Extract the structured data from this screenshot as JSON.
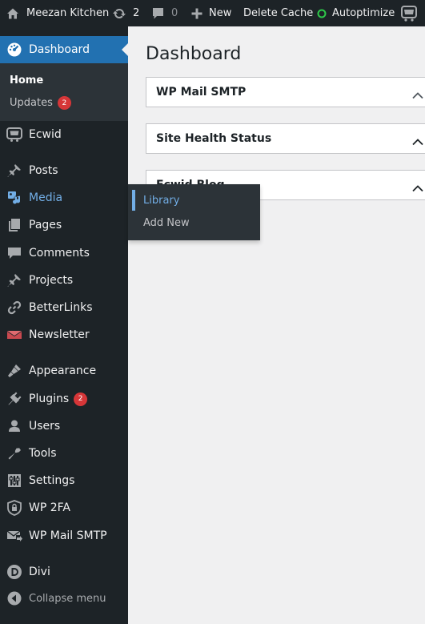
{
  "adminbar": {
    "site_name": "Meezan Kitchen",
    "updates_count": "2",
    "comments_count": "0",
    "new_label": "New",
    "delete_cache_label": "Delete Cache",
    "autoptimize_label": "Autoptimize"
  },
  "sidebar": {
    "dashboard": "Dashboard",
    "home": "Home",
    "updates": "Updates",
    "updates_badge": "2",
    "ecwid": "Ecwid",
    "posts": "Posts",
    "media": "Media",
    "pages": "Pages",
    "comments": "Comments",
    "projects": "Projects",
    "betterlinks": "BetterLinks",
    "newsletter": "Newsletter",
    "appearance": "Appearance",
    "plugins": "Plugins",
    "plugins_badge": "2",
    "users": "Users",
    "tools": "Tools",
    "settings": "Settings",
    "wp2fa": "WP 2FA",
    "wpmailsmtp": "WP Mail SMTP",
    "divi": "Divi",
    "collapse": "Collapse menu"
  },
  "flyout": {
    "library": "Library",
    "add_new": "Add New"
  },
  "main": {
    "title": "Dashboard",
    "widgets": [
      "WP Mail SMTP",
      "Site Health Status",
      "Ecwid Blog"
    ]
  },
  "colors": {
    "accent": "#2271b1",
    "highlight": "#72aee6",
    "badge": "#d63638",
    "autoptimize_ok": "#2ec94a"
  }
}
